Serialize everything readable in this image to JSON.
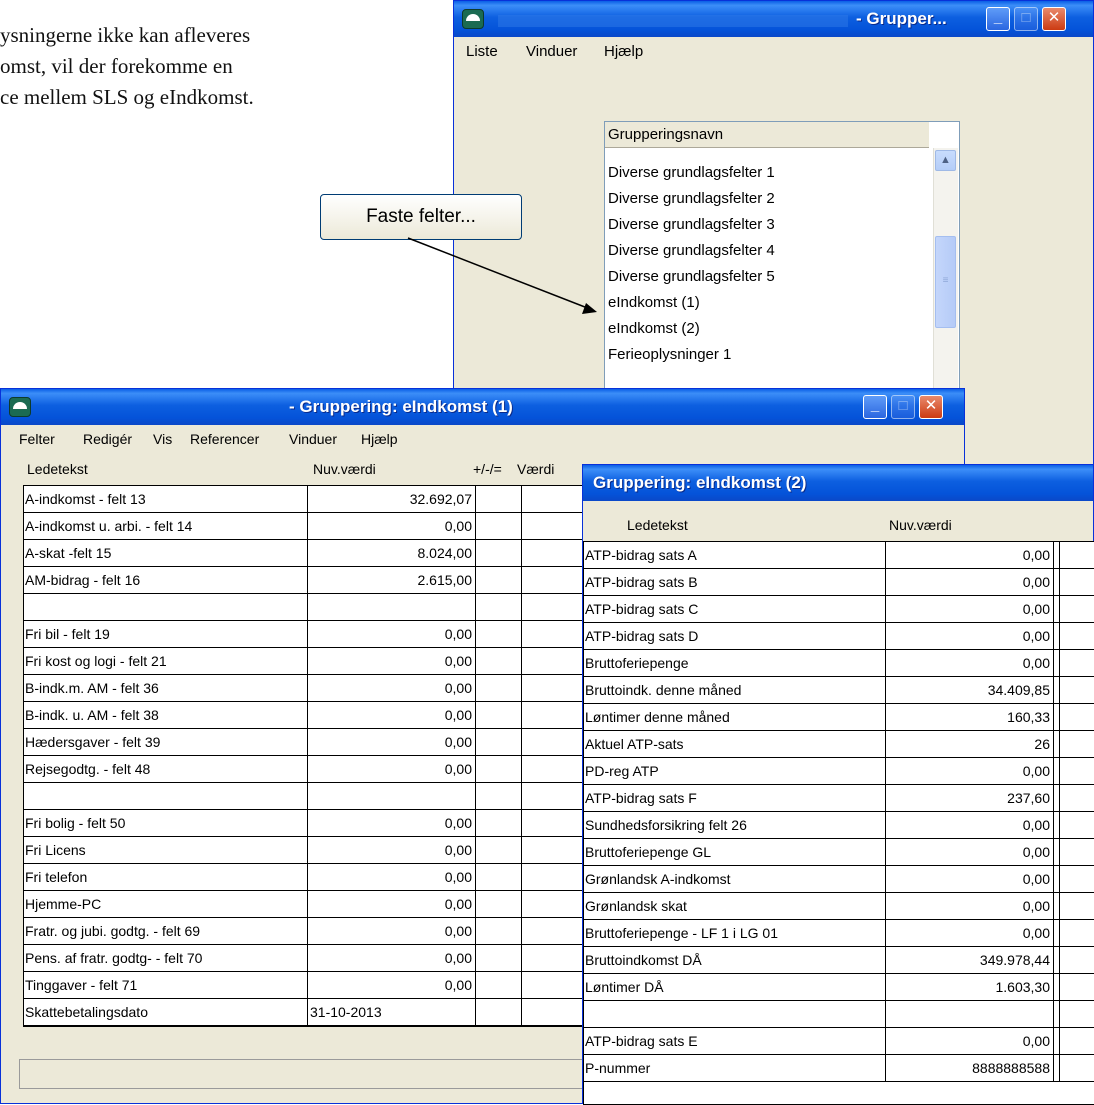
{
  "document_text": [
    "ysningerne ikke kan afleveres",
    "omst, vil der forekomme en",
    "ce mellem SLS og eIndkomst."
  ],
  "window_list": {
    "title": "- Grupper...",
    "menu": [
      "Liste",
      "Vinduer",
      "Hjælp"
    ],
    "column_header": "Grupperingsnavn",
    "items": [
      "Diverse grundlagsfelter 1",
      "Diverse grundlagsfelter 2",
      "Diverse grundlagsfelter 3",
      "Diverse grundlagsfelter 4",
      "Diverse grundlagsfelter 5",
      "eIndkomst (1)",
      "eIndkomst (2)",
      "Ferieoplysninger 1"
    ]
  },
  "faste_button": "Faste felter...",
  "window_eindkomst1": {
    "title": "- Gruppering: eIndkomst (1)",
    "menu": [
      "Felter",
      "Redigér",
      "Vis",
      "Referencer",
      "Vinduer",
      "Hjælp"
    ],
    "headers": {
      "ledetekst": "Ledetekst",
      "nuv": "Nuv.værdi",
      "op": "+/-/=",
      "vaerdi": "Værdi"
    },
    "rows": [
      {
        "label": "A-indkomst - felt 13",
        "value": "32.692,07"
      },
      {
        "label": "A-indkomst u. arbi. - felt 14",
        "value": "0,00"
      },
      {
        "label": "A-skat -felt 15",
        "value": "8.024,00"
      },
      {
        "label": "AM-bidrag - felt 16",
        "value": "2.615,00"
      },
      {
        "label": "",
        "value": ""
      },
      {
        "label": "Fri bil - felt 19",
        "value": "0,00"
      },
      {
        "label": "Fri kost og logi - felt 21",
        "value": "0,00"
      },
      {
        "label": "B-indk.m. AM - felt 36",
        "value": "0,00"
      },
      {
        "label": "B-indk. u. AM - felt 38",
        "value": "0,00"
      },
      {
        "label": "Hædersgaver - felt 39",
        "value": "0,00"
      },
      {
        "label": "Rejsegodtg. - felt 48",
        "value": "0,00"
      },
      {
        "label": "",
        "value": ""
      },
      {
        "label": "Fri bolig - felt 50",
        "value": "0,00"
      },
      {
        "label": "Fri Licens",
        "value": "0,00"
      },
      {
        "label": "Fri telefon",
        "value": "0,00"
      },
      {
        "label": "Hjemme-PC",
        "value": "0,00"
      },
      {
        "label": "Fratr. og jubi. godtg. - felt 69",
        "value": "0,00"
      },
      {
        "label": "Pens. af fratr. godtg- - felt 70",
        "value": "0,00"
      },
      {
        "label": "Tinggaver - felt 71",
        "value": "0,00"
      },
      {
        "label": "Skattebetalingsdato",
        "value": "31-10-2013",
        "date": true
      }
    ]
  },
  "window_eindkomst2": {
    "title": "Gruppering: eIndkomst (2)",
    "headers": {
      "ledetekst": "Ledetekst",
      "nuv": "Nuv.værdi"
    },
    "rows": [
      {
        "label": "ATP-bidrag sats A",
        "value": "0,00"
      },
      {
        "label": "ATP-bidrag sats B",
        "value": "0,00"
      },
      {
        "label": "ATP-bidrag sats C",
        "value": "0,00"
      },
      {
        "label": "ATP-bidrag sats D",
        "value": "0,00"
      },
      {
        "label": "Bruttoferiepenge",
        "value": "0,00"
      },
      {
        "label": "Bruttoindk. denne måned",
        "value": "34.409,85"
      },
      {
        "label": "Løntimer denne måned",
        "value": "160,33"
      },
      {
        "label": "Aktuel ATP-sats",
        "value": "26"
      },
      {
        "label": "PD-reg ATP",
        "value": "0,00"
      },
      {
        "label": "ATP-bidrag sats F",
        "value": "237,60"
      },
      {
        "label": "Sundhedsforsikring felt 26",
        "value": "0,00"
      },
      {
        "label": "Bruttoferiepenge GL",
        "value": "0,00"
      },
      {
        "label": "Grønlandsk A-indkomst",
        "value": "0,00"
      },
      {
        "label": "Grønlandsk skat",
        "value": "0,00"
      },
      {
        "label": "Bruttoferiepenge - LF 1 i LG 01",
        "value": "0,00"
      },
      {
        "label": "Bruttoindkomst DÅ",
        "value": "349.978,44"
      },
      {
        "label": "Løntimer DÅ",
        "value": "1.603,30"
      },
      {
        "label": "",
        "value": ""
      },
      {
        "label": "ATP-bidrag sats E",
        "value": "0,00"
      },
      {
        "label": "P-nummer",
        "value": "8888888588"
      }
    ]
  }
}
